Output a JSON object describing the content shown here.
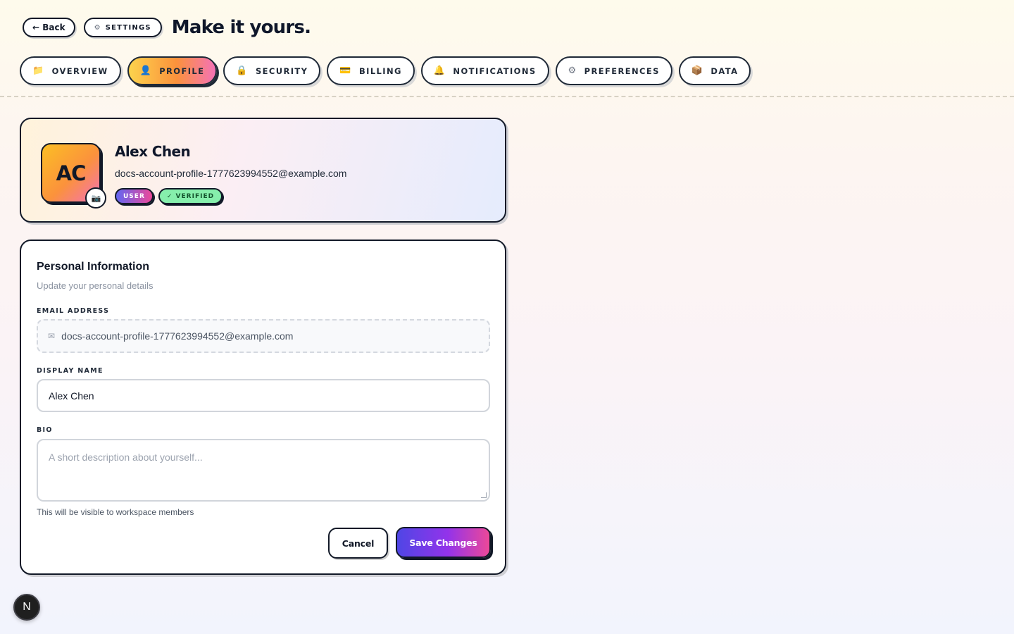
{
  "header": {
    "back_label": "← Back",
    "settings_label": "SETTINGS",
    "settings_icon": "gear-icon",
    "title": "Make it yours."
  },
  "tabs": [
    {
      "label": "OVERVIEW",
      "icon": "📁",
      "icon_name": "folder-icon",
      "active": false
    },
    {
      "label": "PROFILE",
      "icon": "👤",
      "icon_name": "user-icon",
      "active": true
    },
    {
      "label": "SECURITY",
      "icon": "🔒",
      "icon_name": "lock-icon",
      "active": false
    },
    {
      "label": "BILLING",
      "icon": "💳",
      "icon_name": "credit-card-icon",
      "active": false
    },
    {
      "label": "NOTIFICATIONS",
      "icon": "🔔",
      "icon_name": "bell-icon",
      "active": false
    },
    {
      "label": "PREFERENCES",
      "icon": "⚙",
      "icon_name": "gear-icon",
      "active": false
    },
    {
      "label": "DATA",
      "icon": "📦",
      "icon_name": "package-icon",
      "active": false
    }
  ],
  "profile": {
    "initials": "AC",
    "name": "Alex Chen",
    "email": "docs-account-profile-1777623994552@example.com",
    "badges": {
      "role": "USER",
      "verified": "✓ VERIFIED"
    },
    "colors": {
      "role_gradient": [
        "#6366f1",
        "#ec4899"
      ],
      "verified": "#86efac"
    }
  },
  "personal_info": {
    "title": "Personal Information",
    "subtitle": "Update your personal details",
    "email_label": "EMAIL ADDRESS",
    "email_value": "docs-account-profile-1777623994552@example.com",
    "display_name_label": "DISPLAY NAME",
    "display_name_value": "Alex Chen",
    "bio_label": "BIO",
    "bio_value": "",
    "bio_placeholder": "A short description about yourself...",
    "bio_hint": "This will be visible to workspace members",
    "cancel_label": "Cancel",
    "save_label": "Save Changes"
  },
  "dev_badge": {
    "label": "N"
  }
}
